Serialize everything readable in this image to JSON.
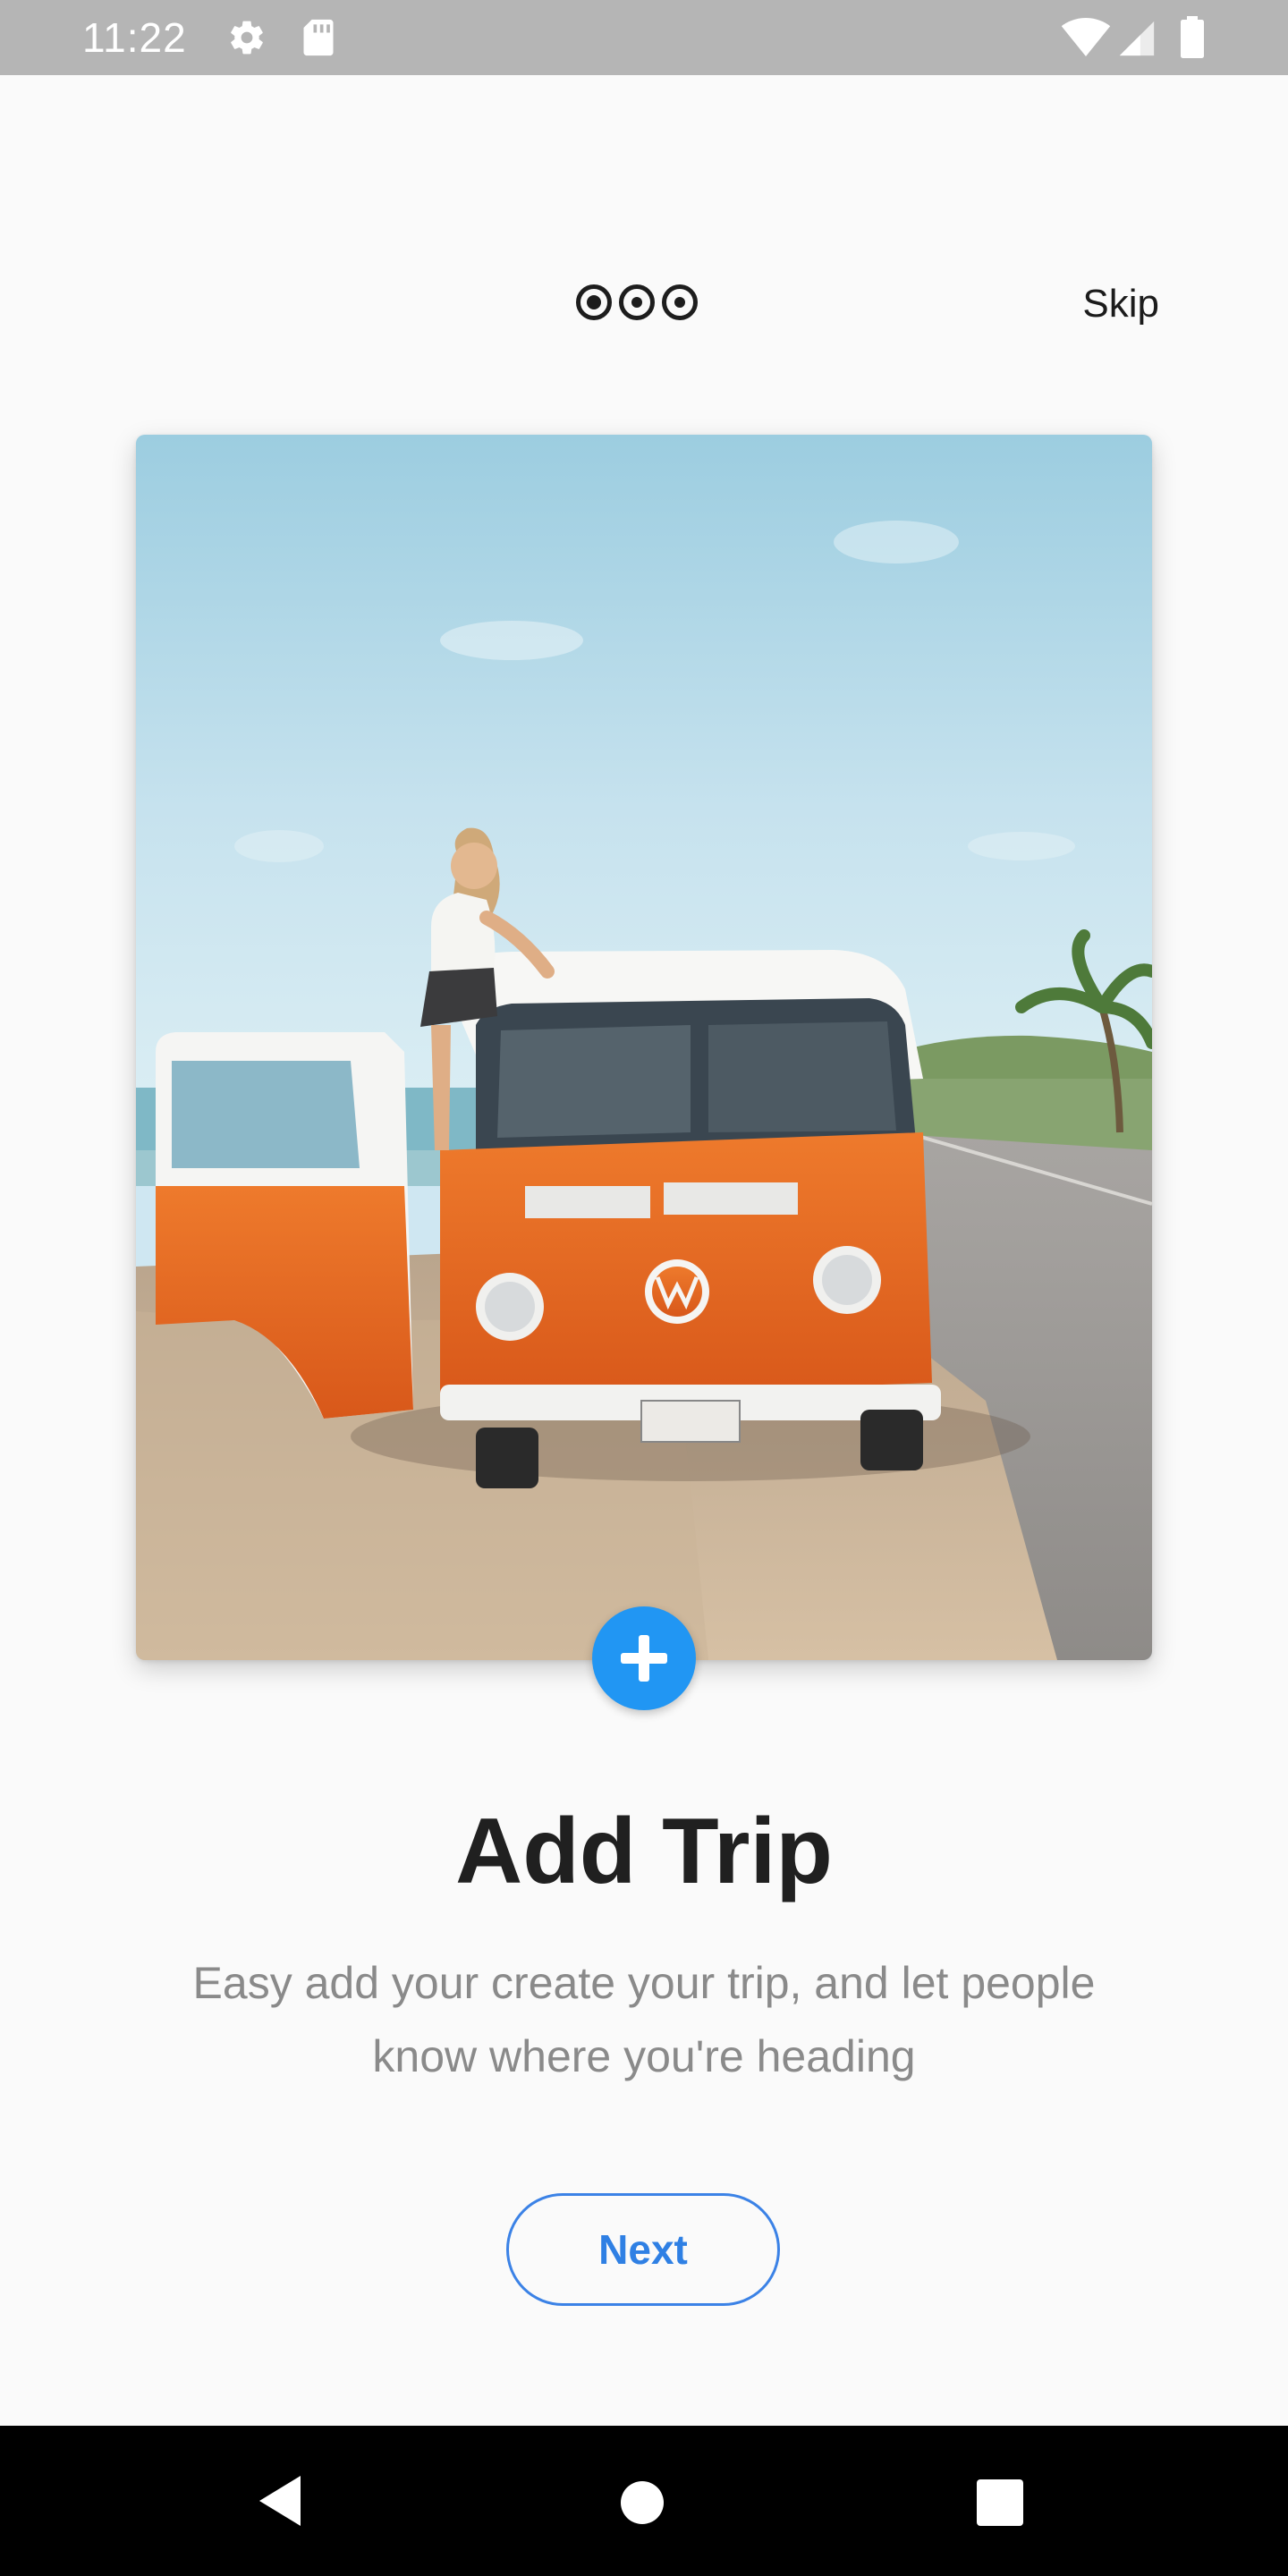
{
  "status_bar": {
    "time": "11:22",
    "icons": [
      "gear-icon",
      "sd-card-icon",
      "wifi-icon",
      "signal-icon",
      "battery-icon"
    ]
  },
  "onboarding": {
    "page_indicator": {
      "count": 3,
      "active_index": 0
    },
    "skip_label": "Skip",
    "image_alt": "Woman sitting on an orange camper van parked by the beach road",
    "add_icon": "plus-icon",
    "title": "Add Trip",
    "description": "Easy add your create your trip, and let people know where you're heading",
    "next_label": "Next"
  },
  "navigation_bar": {
    "buttons": [
      "back-icon",
      "home-icon",
      "recents-icon"
    ]
  },
  "colors": {
    "accent": "#2196f3",
    "next_text": "#2f80e4",
    "background": "#fafafa",
    "status_bar": "#b5b5b5",
    "nav_bar": "#000000"
  }
}
